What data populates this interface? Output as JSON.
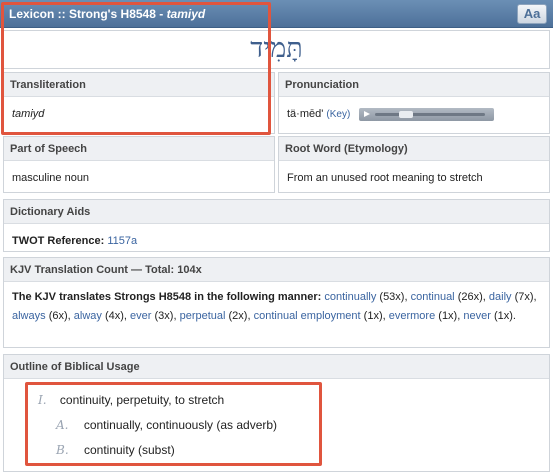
{
  "title": {
    "prefix": "Lexicon :: Strong's H8548 - ",
    "word": "tamiyd"
  },
  "font_button": "Aa",
  "hebrew": "תָּמִיד",
  "transliteration": {
    "header": "Transliteration",
    "value": "tamiyd"
  },
  "pronunciation": {
    "header": "Pronunciation",
    "value": "tä·mēd'",
    "key_label": "(Key)"
  },
  "part_of_speech": {
    "header": "Part of Speech",
    "value": "masculine noun"
  },
  "root_word": {
    "header": "Root Word (Etymology)",
    "value": "From an unused root meaning to stretch"
  },
  "dictionary_aids": {
    "header": "Dictionary Aids",
    "label": "TWOT Reference:",
    "value": "1157a"
  },
  "kjv": {
    "header": "KJV Translation Count — Total: 104x",
    "intro": "The KJV translates Strongs H8548 in the following manner:",
    "items": [
      {
        "word": "continually",
        "count": "(53x)"
      },
      {
        "word": "continual",
        "count": "(26x)"
      },
      {
        "word": "daily",
        "count": "(7x)"
      },
      {
        "word": "always",
        "count": "(6x)"
      },
      {
        "word": "alway",
        "count": "(4x)"
      },
      {
        "word": "ever",
        "count": "(3x)"
      },
      {
        "word": "perpetual",
        "count": "(2x)"
      },
      {
        "word": "continual employment",
        "count": "(1x)"
      },
      {
        "word": "evermore",
        "count": "(1x)"
      },
      {
        "word": "never",
        "count": "(1x)"
      }
    ]
  },
  "outline": {
    "header": "Outline of Biblical Usage",
    "items": [
      {
        "marker": "I.",
        "text": "continuity, perpetuity, to stretch"
      },
      {
        "marker": "A.",
        "text": "continually, continuously (as adverb)"
      },
      {
        "marker": "B.",
        "text": "continuity (subst)"
      }
    ]
  },
  "colors": {
    "header_bar": "#4d7099",
    "link": "#3a64a0",
    "highlight": "#e0553e"
  }
}
